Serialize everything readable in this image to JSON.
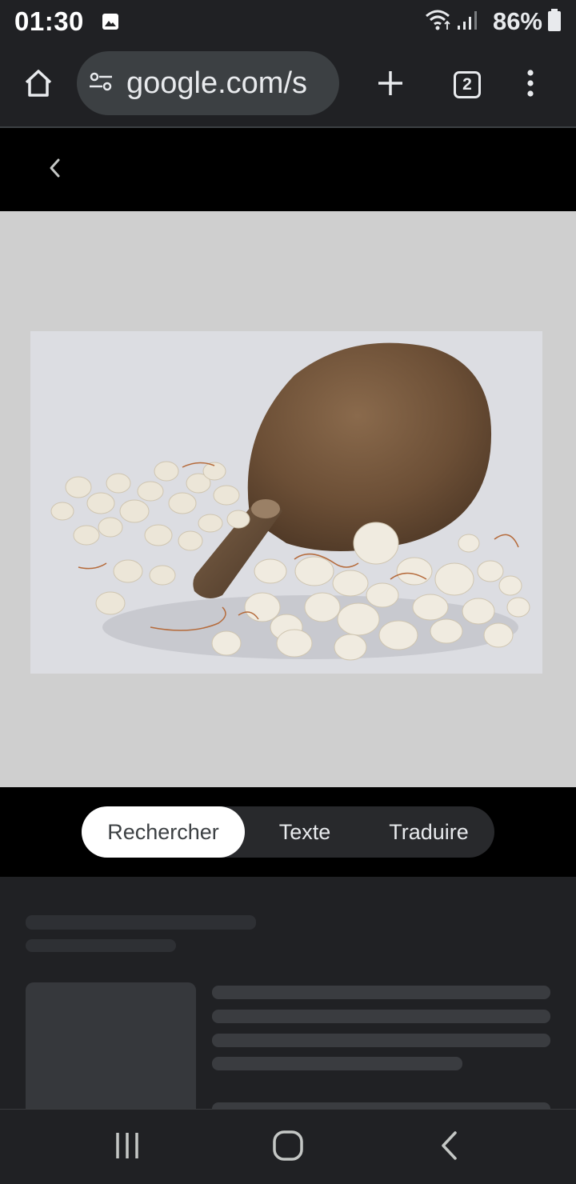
{
  "status_bar": {
    "time": "01:30",
    "battery": "86%",
    "icons": [
      "gallery-icon",
      "wifi-icon",
      "signal-icon",
      "battery-icon"
    ]
  },
  "toolbar": {
    "url": "google.com/s",
    "tab_count": "2",
    "icons": [
      "home-icon",
      "site-settings-icon",
      "plus-icon",
      "tabs-icon",
      "more-vert-icon"
    ]
  },
  "lens": {
    "back_icon": "chevron-left-icon",
    "segments": [
      "Rechercher",
      "Texte",
      "Traduire"
    ],
    "selected_segment": "Rechercher"
  },
  "navbar": {
    "icons": [
      "recents-icon",
      "home-circle-icon",
      "back-icon"
    ]
  },
  "colors": {
    "toolbar_bg": "#202124",
    "image_bg": "#cfcfcf",
    "segment_active_bg": "#ffffff",
    "results_bg": "#202124"
  }
}
